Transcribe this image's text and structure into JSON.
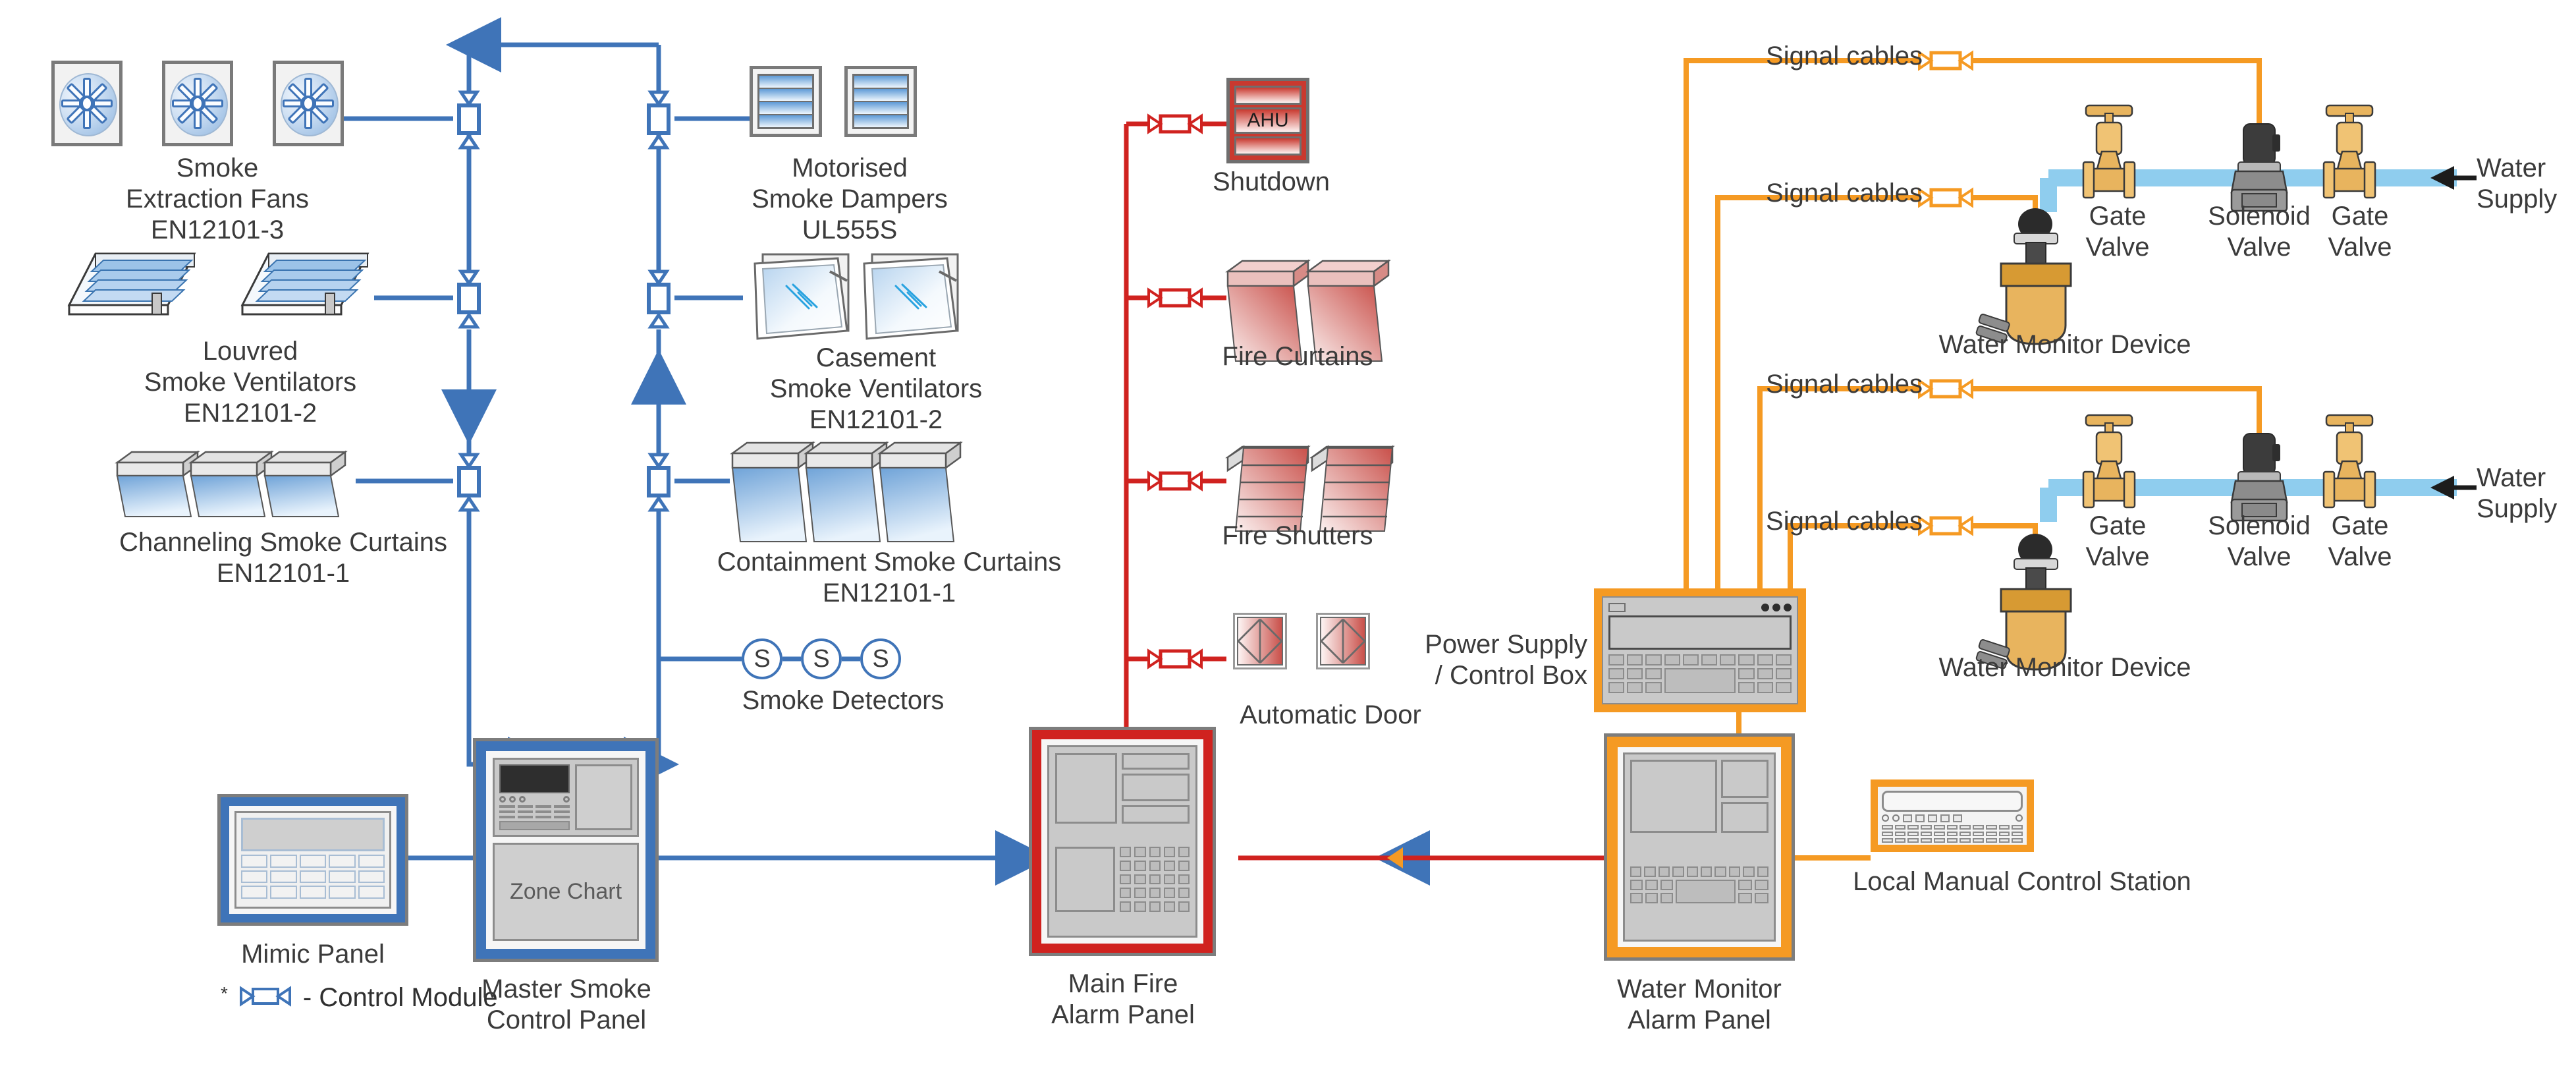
{
  "diagram": {
    "title": "Smoke Control and Fire Alarm System Schematic",
    "colors": {
      "smoke_blue": "#3f74b8",
      "fire_red": "#d0221f",
      "water_orange": "#f59a23",
      "water_pipe": "#8fcdee",
      "panel_grey": "#7d7d7d"
    }
  },
  "devices": {
    "smoke_extraction_fans": {
      "label": "Smoke\nExtraction Fans\nEN12101-3",
      "count": 3
    },
    "louvred_ventilators": {
      "label": "Louvred\nSmoke Ventilators\nEN12101-2",
      "count": 2
    },
    "channeling_curtains": {
      "label": "Channeling Smoke Curtains\nEN12101-1",
      "count": 3
    },
    "motorised_dampers": {
      "label": "Motorised\nSmoke Dampers\nUL555S",
      "count": 2
    },
    "casement_ventilators": {
      "label": "Casement\nSmoke Ventilators\nEN12101-2",
      "count": 2
    },
    "containment_curtains": {
      "label": "Containment Smoke Curtains\nEN12101-1",
      "count": 3
    },
    "smoke_detectors": {
      "label": "Smoke Detectors",
      "symbol": "S",
      "count": 3
    },
    "ahu_shutdown": {
      "label": "Shutdown",
      "badge": "AHU"
    },
    "fire_curtains": {
      "label": "Fire Curtains",
      "count": 2
    },
    "fire_shutters": {
      "label": "Fire Shutters",
      "count": 2
    },
    "automatic_door": {
      "label": "Automatic Door",
      "count": 2
    },
    "water_monitor_device_1": {
      "label": "Water Monitor Device"
    },
    "water_monitor_device_2": {
      "label": "Water Monitor Device"
    },
    "gate_valve_1a": {
      "label": "Gate\nValve"
    },
    "solenoid_valve_1": {
      "label": "Solenoid\nValve"
    },
    "gate_valve_1b": {
      "label": "Gate\nValve"
    },
    "gate_valve_2a": {
      "label": "Gate\nValve"
    },
    "solenoid_valve_2": {
      "label": "Solenoid\nValve"
    },
    "gate_valve_2b": {
      "label": "Gate\nValve"
    },
    "water_supply_1": {
      "label": "Water\nSupply"
    },
    "water_supply_2": {
      "label": "Water\nSupply"
    }
  },
  "panels": {
    "mimic_panel": {
      "label": "Mimic Panel"
    },
    "master_smoke_control_panel": {
      "label": "Master Smoke\nControl Panel",
      "display_label": "Zone Chart"
    },
    "main_fire_alarm_panel": {
      "label": "Main Fire\nAlarm Panel"
    },
    "water_monitor_alarm_panel": {
      "label": "Water Monitor\nAlarm Panel"
    },
    "power_supply_control_box": {
      "label": "Power Supply\n/ Control Box"
    },
    "local_manual_control_station": {
      "label": "Local Manual Control Station"
    }
  },
  "cables": {
    "signal_cable_1": {
      "label": "Signal cables"
    },
    "signal_cable_2": {
      "label": "Signal cables"
    },
    "signal_cable_3": {
      "label": "Signal cables"
    },
    "signal_cable_4": {
      "label": "Signal cables"
    }
  },
  "legend": {
    "asterisk": "*",
    "control_module": "- Control Module"
  }
}
